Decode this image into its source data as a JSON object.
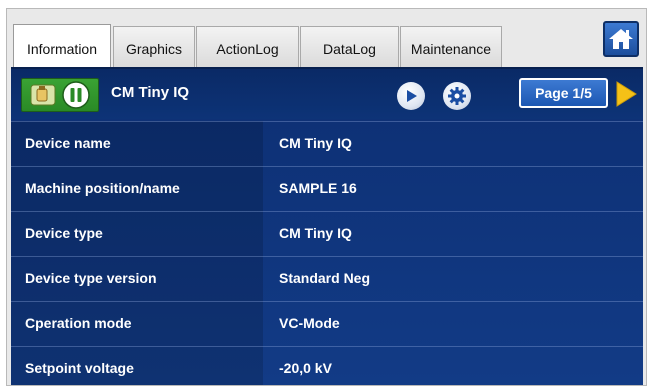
{
  "tabs": [
    {
      "label": "Information",
      "active": true
    },
    {
      "label": "Graphics",
      "active": false
    },
    {
      "label": "ActionLog",
      "active": false
    },
    {
      "label": "DataLog",
      "active": false
    },
    {
      "label": "Maintenance",
      "active": false
    }
  ],
  "header": {
    "title": "CM Tiny IQ",
    "page_label": "Page 1/5"
  },
  "icons": {
    "home": "home-icon",
    "device_status": "device-icon",
    "pause": "pause-icon",
    "play": "play-icon",
    "settings": "gear-icon",
    "next": "arrow-right-icon"
  },
  "colors": {
    "panel_blue": "#123b86",
    "status_green": "#3aa334",
    "arrow_yellow": "#f5c117"
  },
  "rows": [
    {
      "label": "Device name",
      "value": "CM Tiny IQ"
    },
    {
      "label": "Machine position/name",
      "value": "SAMPLE 16"
    },
    {
      "label": "Device type",
      "value": "CM Tiny IQ"
    },
    {
      "label": "Device type version",
      "value": "Standard Neg"
    },
    {
      "label": "Cperation mode",
      "value": "VC-Mode"
    },
    {
      "label": "Setpoint voltage",
      "value": "-20,0 kV"
    }
  ]
}
